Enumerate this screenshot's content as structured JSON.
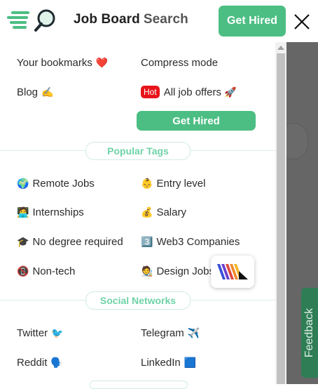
{
  "header": {
    "brand_part1": "Job Board",
    "brand_part2": "Search",
    "cta_label": "Get Hired"
  },
  "menu": {
    "bookmarks_label": "Your bookmarks",
    "bookmarks_emoji": "❤️",
    "compress_label": "Compress mode",
    "blog_label": "Blog",
    "blog_emoji": "✍️",
    "hot_badge": "Hot",
    "all_jobs_label": "All job offers",
    "all_jobs_emoji": "🚀",
    "get_hired_label": "Get Hired"
  },
  "popular_tags": {
    "title": "Popular Tags",
    "items": [
      {
        "emoji": "🌍",
        "label": "Remote Jobs"
      },
      {
        "emoji": "👶",
        "label": "Entry level"
      },
      {
        "emoji": "🧑‍💻",
        "label": "Internships"
      },
      {
        "emoji": "💰",
        "label": "Salary"
      },
      {
        "emoji": "🎓",
        "label": "No degree required"
      },
      {
        "emoji": "3️⃣",
        "label": "Web3 Companies"
      },
      {
        "emoji": "📵",
        "label": "Non-tech"
      },
      {
        "emoji": "🧑‍🎨",
        "label": "Design Jobs"
      }
    ]
  },
  "social_networks": {
    "title": "Social Networks",
    "items": [
      {
        "emoji": "🐦",
        "label": "Twitter"
      },
      {
        "emoji": "✈️",
        "label": "Telegram"
      },
      {
        "emoji": "🗣️",
        "label": "Reddit"
      },
      {
        "emoji": "🟦",
        "label": "LinkedIn"
      }
    ]
  },
  "feedback_tab": "Feedback",
  "colors": {
    "accent_green": "#4cbe83",
    "hot_red": "#e8141b",
    "pill_text": "#6fd3a6",
    "overlay": "#666666",
    "feedback_bg": "#2e7d55"
  }
}
